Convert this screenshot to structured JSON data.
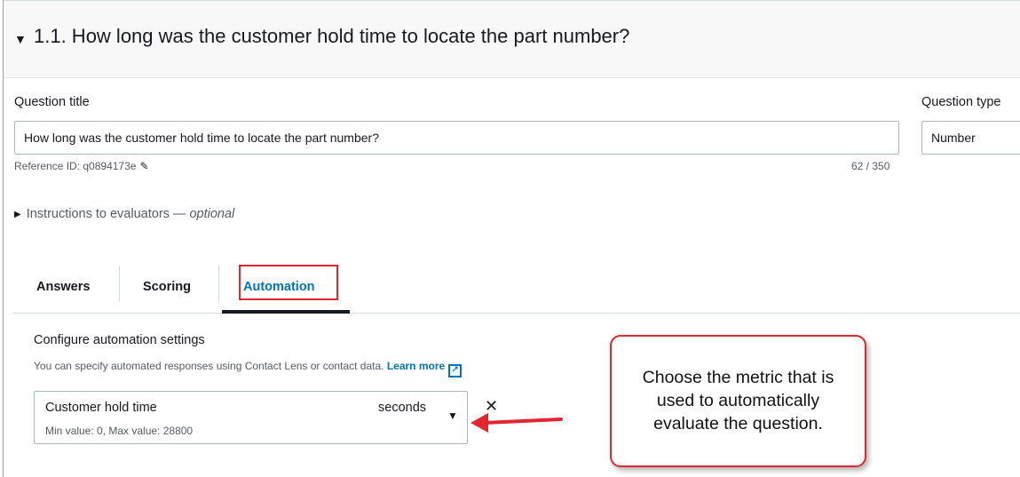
{
  "section": {
    "caret": "▼",
    "title": "1.1. How long was the customer hold time to locate the part number?"
  },
  "question_title": {
    "label": "Question title",
    "value": "How long was the customer hold time to locate the part number?",
    "reference_id": "Reference ID: q0894173e",
    "char_count": "62 / 350"
  },
  "question_type": {
    "label": "Question type",
    "value": "Number"
  },
  "instructions": {
    "label": "Instructions to evaluators — ",
    "optional": "optional"
  },
  "tabs": [
    {
      "label": "Answers"
    },
    {
      "label": "Scoring"
    },
    {
      "label": "Automation",
      "active": true
    }
  ],
  "automation": {
    "title": "Configure automation settings",
    "description": "You can specify automated responses using Contact Lens or contact data. ",
    "learn_more": "Learn more",
    "metric": {
      "value": "Customer hold time",
      "constraint": "Min value: 0, Max value: 28800",
      "unit": "seconds"
    }
  },
  "callout": {
    "lines": [
      "Choose the metric that is",
      "used to automatically",
      "evaluate the question."
    ]
  },
  "colors": {
    "accent": "#0073bb",
    "annotation_red": "#e0262e"
  },
  "icons": [
    "pencil-icon",
    "external-link-icon",
    "dropdown-arrow-icon",
    "clear-icon",
    "caret-down-icon",
    "caret-right-icon",
    "arrow-annotation"
  ]
}
